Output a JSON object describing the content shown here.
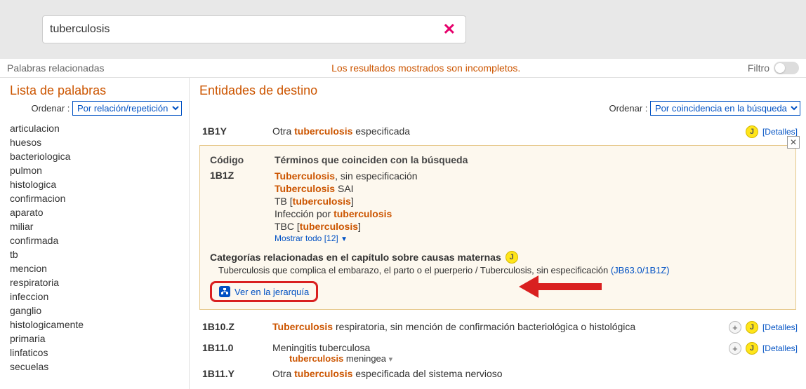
{
  "search": {
    "value": "tuberculosis"
  },
  "status": {
    "related": "Palabras relacionadas",
    "incomplete": "Los resultados mostrados son incompletos.",
    "filter": "Filtro"
  },
  "sidebar": {
    "title": "Lista de palabras",
    "sort_label": "Ordenar :",
    "sort_option": "Por relación/repetición",
    "words": [
      "articulacion",
      "huesos",
      "bacteriologica",
      "pulmon",
      "histologica",
      "confirmacion",
      "aparato",
      "miliar",
      "confirmada",
      "tb",
      "mencion",
      "respiratoria",
      "infeccion",
      "ganglio",
      "histologicamente",
      "primaria",
      "linfaticos",
      "secuelas"
    ]
  },
  "content": {
    "title": "Entidades de destino",
    "sort_label": "Ordenar :",
    "sort_option": "Por coincidencia en la búsqueda",
    "detalles": "[Detalles]"
  },
  "results": {
    "r0": {
      "code": "1B1Y",
      "pre": "Otra ",
      "hl": "tuberculosis",
      "post": " especificada"
    },
    "r2": {
      "code": "1B10.Z",
      "hl": "Tuberculosis",
      "post": " respiratoria, sin mención de confirmación bacteriológica o histológica"
    },
    "r3": {
      "code": "1B11.0",
      "title": "Meningitis tuberculosa",
      "sub_hl": "tuberculosis",
      "sub_post": " meningea"
    },
    "r4": {
      "code": "1B11.Y",
      "pre": "Otra ",
      "hl": "tuberculosis",
      "post": " especificada del sistema nervioso"
    }
  },
  "detail": {
    "header_code": "Código",
    "header_terms": "Términos que coinciden con la búsqueda",
    "code": "1B1Z",
    "t1_hl": "Tuberculosis",
    "t1_post": ", sin especificación",
    "t2_hl": "Tuberculosis",
    "t2_post": " SAI",
    "t3_pre": "TB [",
    "t3_hl": "tuberculosis",
    "t3_post": "]",
    "t4_pre": "Infección por ",
    "t4_hl": "tuberculosis",
    "t5_pre": "TBC [",
    "t5_hl": "tuberculosis",
    "t5_post": "]",
    "showall": "Mostrar todo [12]",
    "cat_title": "Categorías relacionadas en el capítulo sobre causas maternas",
    "cat_text": "Tuberculosis que complica el embarazo, el parto o el puerperio / Tuberculosis, sin especificación ",
    "cat_code": "(JB63.0/1B1Z)",
    "hier_btn": "Ver en la jerarquía"
  }
}
